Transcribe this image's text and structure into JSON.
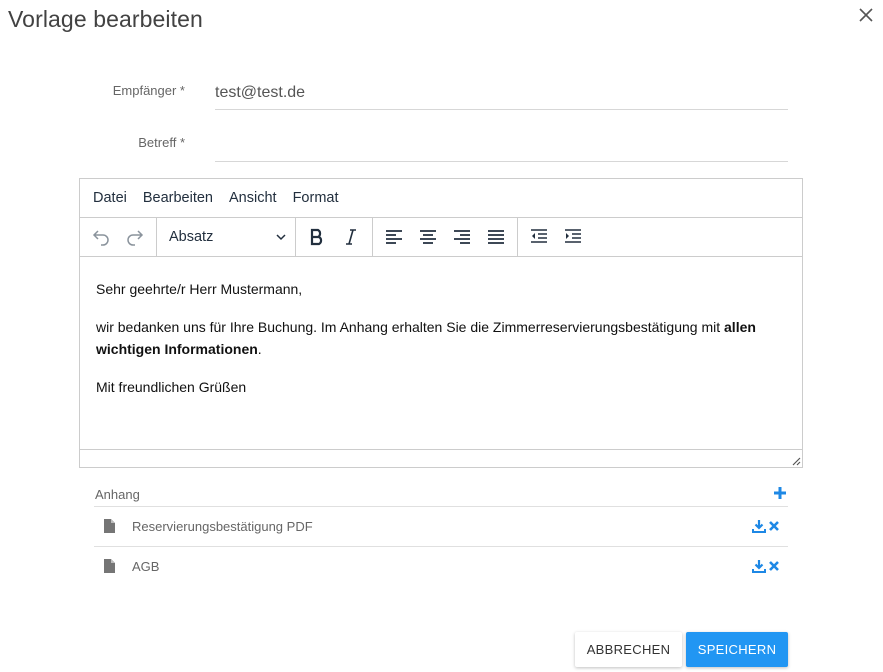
{
  "dialog": {
    "title": "Vorlage bearbeiten"
  },
  "form": {
    "recipient_label": "Empfänger *",
    "recipient_value": "test@test.de",
    "subject_label": "Betreff *",
    "subject_value": ""
  },
  "editor": {
    "menu": [
      "Datei",
      "Bearbeiten",
      "Ansicht",
      "Format"
    ],
    "block_format": "Absatz",
    "content": {
      "greeting": "Sehr geehrte/r Herr Mustermann,",
      "body_text": "wir bedanken uns für Ihre Buchung. Im Anhang erhalten Sie die Zimmerreservierungsbestätigung mit ",
      "body_bold": "allen wichtigen Informationen",
      "body_end": ".",
      "closing": "Mit freundlichen Grüßen"
    }
  },
  "attachments": {
    "title": "Anhang",
    "items": [
      {
        "name": "Reservierungsbestätigung PDF"
      },
      {
        "name": "AGB"
      }
    ]
  },
  "actions": {
    "cancel": "ABBRECHEN",
    "save": "SPEICHERN"
  },
  "colors": {
    "accent": "#2196f3",
    "icon_blue": "#1e88e5"
  }
}
